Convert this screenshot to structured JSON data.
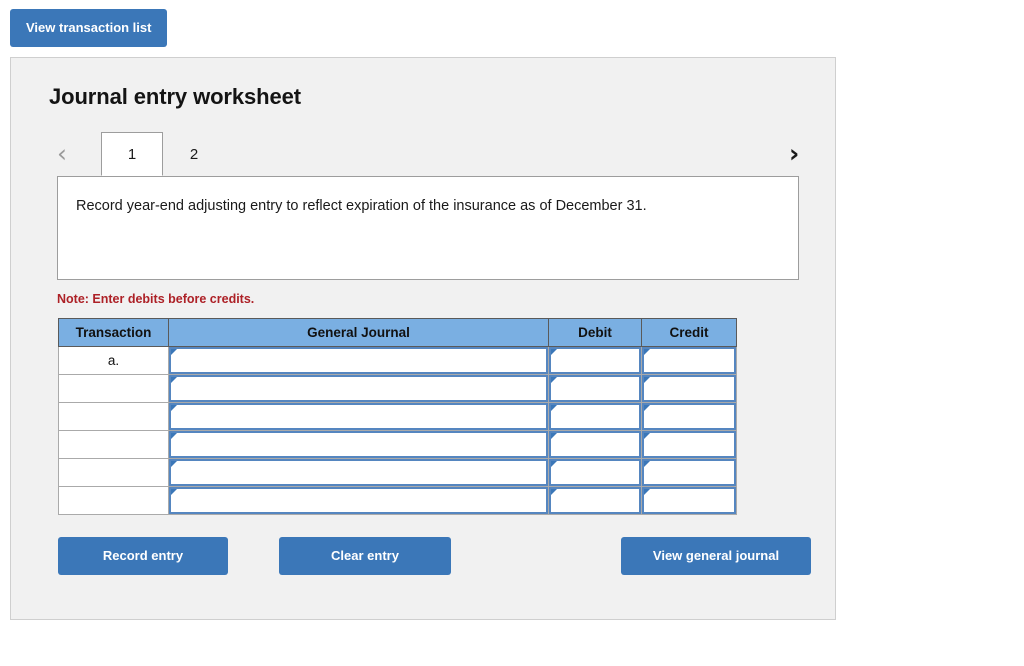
{
  "toolbar": {
    "view_transaction_list_label": "View transaction list"
  },
  "panel": {
    "title": "Journal entry worksheet"
  },
  "tabs": {
    "prev_icon": "chevron-left-icon",
    "next_icon": "chevron-right-icon",
    "prev_glyph": "‹",
    "next_glyph": "›",
    "items": [
      {
        "label": "1",
        "active": true
      },
      {
        "label": "2",
        "active": false
      }
    ]
  },
  "prompt": {
    "text": "Record year-end adjusting entry to reflect expiration of the insurance as of December 31."
  },
  "note": {
    "text": "Note: Enter debits before credits."
  },
  "table": {
    "headers": [
      "Transaction",
      "General Journal",
      "Debit",
      "Credit"
    ],
    "rows": [
      {
        "transaction": "a.",
        "general_journal": "",
        "debit": "",
        "credit": ""
      },
      {
        "transaction": "",
        "general_journal": "",
        "debit": "",
        "credit": ""
      },
      {
        "transaction": "",
        "general_journal": "",
        "debit": "",
        "credit": ""
      },
      {
        "transaction": "",
        "general_journal": "",
        "debit": "",
        "credit": ""
      },
      {
        "transaction": "",
        "general_journal": "",
        "debit": "",
        "credit": ""
      },
      {
        "transaction": "",
        "general_journal": "",
        "debit": "",
        "credit": ""
      }
    ]
  },
  "actions": {
    "record_entry_label": "Record entry",
    "clear_entry_label": "Clear entry",
    "view_general_journal_label": "View general journal"
  },
  "colors": {
    "button_blue": "#3b77b8",
    "header_blue": "#7aafe2",
    "input_border_blue": "#5586c0",
    "note_red": "#ad2127",
    "panel_bg": "#f1f1f1"
  }
}
